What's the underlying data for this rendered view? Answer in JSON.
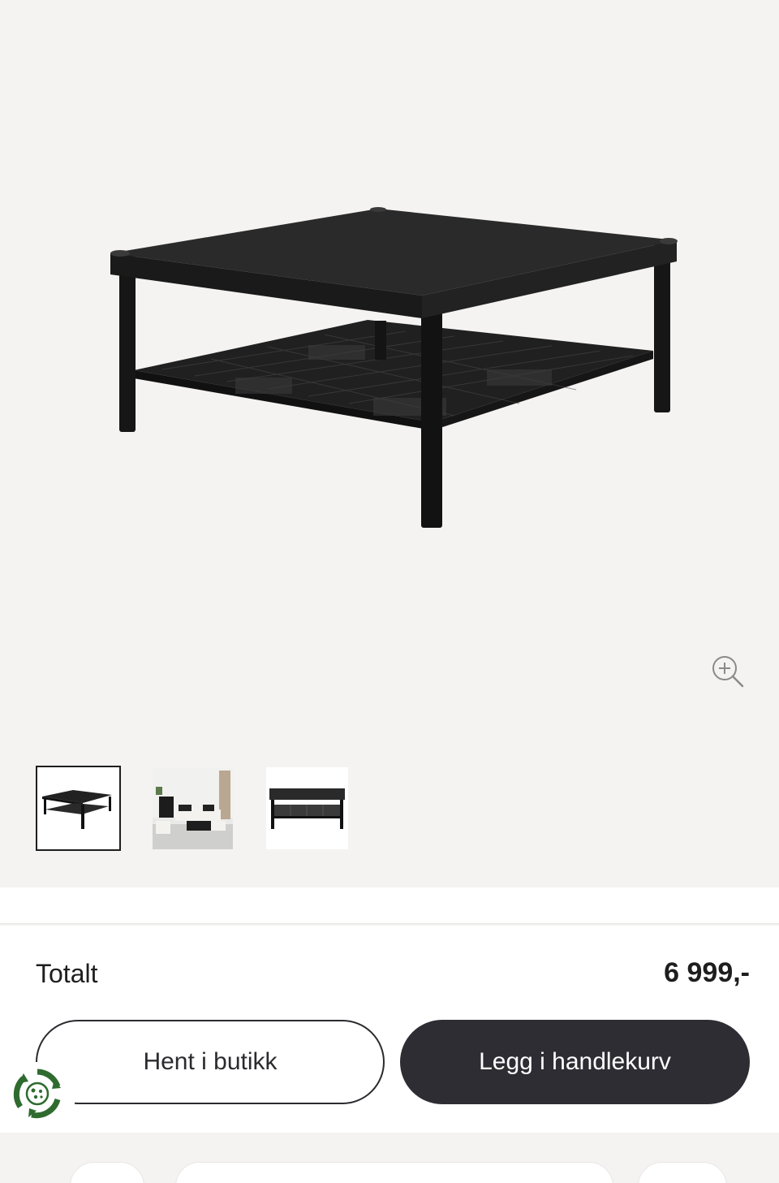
{
  "product": {
    "image_alt": "Black square coffee table with lower rattan shelf",
    "zoom_icon": "zoom-in-icon"
  },
  "thumbnails": [
    {
      "name": "thumbnail-table-front",
      "active": true
    },
    {
      "name": "thumbnail-living-room",
      "active": false
    },
    {
      "name": "thumbnail-table-side",
      "active": false
    }
  ],
  "summary": {
    "total_label": "Totalt",
    "total_price": "6 999,-"
  },
  "actions": {
    "pickup_label": "Hent i butikk",
    "add_to_cart_label": "Legg i handlekurv"
  },
  "colors": {
    "primary_button": "#2d2d33",
    "eco_green": "#2f6b2f",
    "background": "#f5f3f1"
  }
}
